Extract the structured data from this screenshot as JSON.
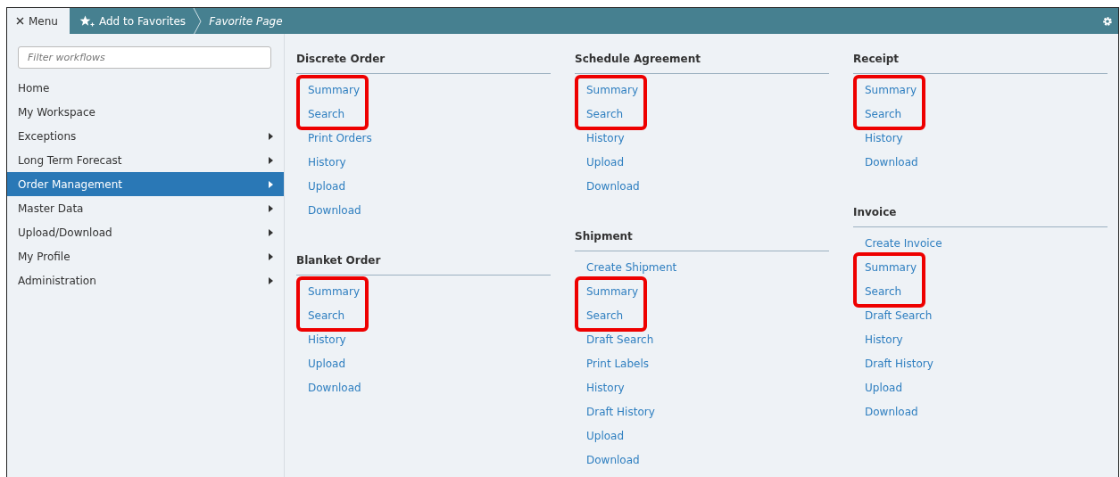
{
  "top_bar": {
    "menu_button": "Menu",
    "breadcrumbs": [
      {
        "label": "Add to Favorites",
        "kind": "action"
      },
      {
        "label": "Favorite Page",
        "kind": "current"
      }
    ]
  },
  "sidebar": {
    "filter": {
      "placeholder": "Filter workflows"
    },
    "items": [
      {
        "label": "Home",
        "has_submenu": false,
        "selected": false
      },
      {
        "label": "My Workspace",
        "has_submenu": false,
        "selected": false
      },
      {
        "label": "Exceptions",
        "has_submenu": true,
        "selected": false
      },
      {
        "label": "Long Term Forecast",
        "has_submenu": true,
        "selected": false
      },
      {
        "label": "Order Management",
        "has_submenu": true,
        "selected": true
      },
      {
        "label": "Master Data",
        "has_submenu": true,
        "selected": false
      },
      {
        "label": "Upload/Download",
        "has_submenu": true,
        "selected": false
      },
      {
        "label": "My Profile",
        "has_submenu": true,
        "selected": false
      },
      {
        "label": "Administration",
        "has_submenu": true,
        "selected": false
      }
    ]
  },
  "columns": [
    {
      "sections": [
        {
          "title": "Discrete Order",
          "links": [
            {
              "label": "Summary",
              "highlighted": true
            },
            {
              "label": "Search",
              "highlighted": true
            },
            {
              "label": "Print Orders",
              "highlighted": false
            },
            {
              "label": "History",
              "highlighted": false
            },
            {
              "label": "Upload",
              "highlighted": false
            },
            {
              "label": "Download",
              "highlighted": false
            }
          ]
        },
        {
          "title": "Blanket Order",
          "links": [
            {
              "label": "Summary",
              "highlighted": true
            },
            {
              "label": "Search",
              "highlighted": true
            },
            {
              "label": "History",
              "highlighted": false
            },
            {
              "label": "Upload",
              "highlighted": false
            },
            {
              "label": "Download",
              "highlighted": false
            }
          ]
        }
      ]
    },
    {
      "sections": [
        {
          "title": "Schedule Agreement",
          "links": [
            {
              "label": "Summary",
              "highlighted": true
            },
            {
              "label": "Search",
              "highlighted": true
            },
            {
              "label": "History",
              "highlighted": false
            },
            {
              "label": "Upload",
              "highlighted": false
            },
            {
              "label": "Download",
              "highlighted": false
            }
          ]
        },
        {
          "title": "Shipment",
          "links": [
            {
              "label": "Create Shipment",
              "highlighted": false
            },
            {
              "label": "Summary",
              "highlighted": true
            },
            {
              "label": "Search",
              "highlighted": true
            },
            {
              "label": "Draft Search",
              "highlighted": false
            },
            {
              "label": "Print Labels",
              "highlighted": false
            },
            {
              "label": "History",
              "highlighted": false
            },
            {
              "label": "Draft History",
              "highlighted": false
            },
            {
              "label": "Upload",
              "highlighted": false
            },
            {
              "label": "Download",
              "highlighted": false
            }
          ]
        }
      ]
    },
    {
      "sections": [
        {
          "title": "Receipt",
          "links": [
            {
              "label": "Summary",
              "highlighted": true
            },
            {
              "label": "Search",
              "highlighted": true
            },
            {
              "label": "History",
              "highlighted": false
            },
            {
              "label": "Download",
              "highlighted": false
            }
          ]
        },
        {
          "title": "Invoice",
          "links": [
            {
              "label": "Create Invoice",
              "highlighted": false
            },
            {
              "label": "Summary",
              "highlighted": true
            },
            {
              "label": "Search",
              "highlighted": true
            },
            {
              "label": "Draft Search",
              "highlighted": false
            },
            {
              "label": "History",
              "highlighted": false
            },
            {
              "label": "Draft History",
              "highlighted": false
            },
            {
              "label": "Upload",
              "highlighted": false
            },
            {
              "label": "Download",
              "highlighted": false
            }
          ]
        }
      ]
    }
  ]
}
